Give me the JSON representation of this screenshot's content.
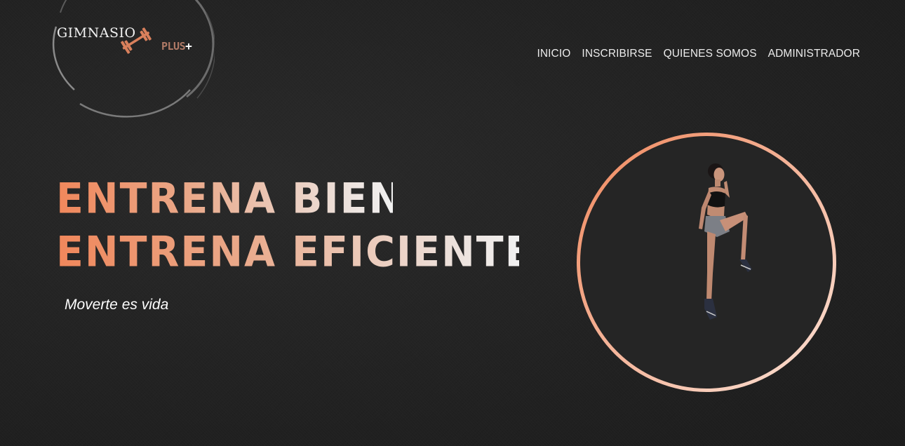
{
  "brand": {
    "name": "GIMNASIO",
    "suffix": "PLUS",
    "suffix_sign": "+",
    "icon": "dumbbell-icon"
  },
  "nav": {
    "items": [
      {
        "label": "INICIO"
      },
      {
        "label": "INSCRIBIRSE"
      },
      {
        "label": "QUIENES SOMOS"
      },
      {
        "label": "ADMINISTRADOR"
      }
    ]
  },
  "hero": {
    "line1": "ENTRENA BIEN.",
    "line2": "ENTRENA EFICIENTE.",
    "tagline_prefix": "Moverte es ",
    "tagline_emphasis": "vida",
    "image": "athlete-jumping-photo"
  },
  "colors": {
    "background": "#232323",
    "accent": "#f0875b",
    "accent_light": "#f1f1f1"
  }
}
